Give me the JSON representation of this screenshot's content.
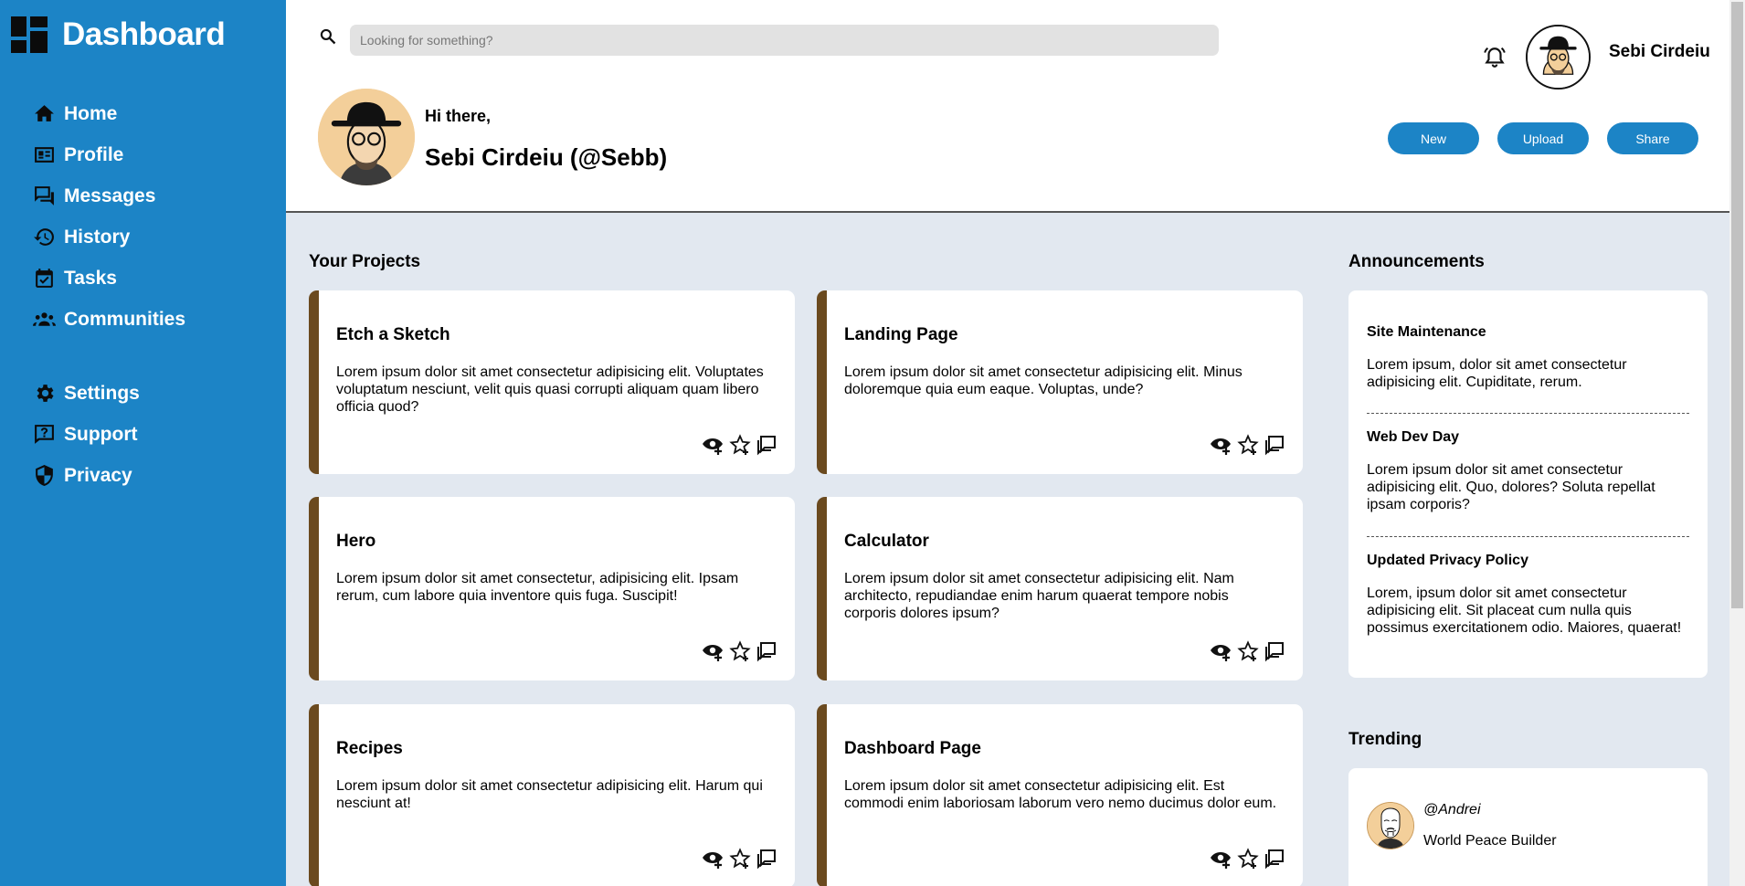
{
  "sidebar": {
    "brand": "Dashboard",
    "nav_primary": [
      {
        "label": "Home",
        "icon": "home-icon"
      },
      {
        "label": "Profile",
        "icon": "profile-card-icon"
      },
      {
        "label": "Messages",
        "icon": "messages-icon"
      },
      {
        "label": "History",
        "icon": "history-icon"
      },
      {
        "label": "Tasks",
        "icon": "tasks-icon"
      },
      {
        "label": "Communities",
        "icon": "communities-icon"
      }
    ],
    "nav_secondary": [
      {
        "label": "Settings",
        "icon": "gear-icon"
      },
      {
        "label": "Support",
        "icon": "support-icon"
      },
      {
        "label": "Privacy",
        "icon": "shield-icon"
      }
    ]
  },
  "header": {
    "search_placeholder": "Looking for something?",
    "user_name": "Sebi Cirdeiu",
    "greeting": "Hi there,",
    "full_name": "Sebi Cirdeiu (@Sebb)",
    "buttons": {
      "new": "New",
      "upload": "Upload",
      "share": "Share"
    }
  },
  "projects": {
    "title": "Your Projects",
    "items": [
      {
        "title": "Etch a Sketch",
        "desc": "Lorem ipsum dolor sit amet consectetur adipisicing elit. Voluptates voluptatum nesciunt, velit quis quasi corrupti aliquam quam libero officia quod?"
      },
      {
        "title": "Landing Page",
        "desc": "Lorem ipsum dolor sit amet consectetur adipisicing elit. Minus doloremque quia eum eaque. Voluptas, unde?"
      },
      {
        "title": "Hero",
        "desc": "Lorem ipsum dolor sit amet consectetur, adipisicing elit. Ipsam rerum, cum labore quia inventore quis fuga. Suscipit!"
      },
      {
        "title": "Calculator",
        "desc": "Lorem ipsum dolor sit amet consectetur adipisicing elit. Nam architecto, repudiandae enim harum quaerat tempore nobis corporis dolores ipsum?"
      },
      {
        "title": "Recipes",
        "desc": "Lorem ipsum dolor sit amet consectetur adipisicing elit. Harum qui nesciunt at!"
      },
      {
        "title": "Dashboard Page",
        "desc": "Lorem ipsum dolor sit amet consectetur adipisicing elit. Est commodi enim laboriosam laborum vero nemo ducimus dolor eum."
      }
    ]
  },
  "announcements": {
    "title": "Announcements",
    "items": [
      {
        "title": "Site Maintenance",
        "text": "Lorem ipsum, dolor sit amet consectetur adipisicing elit. Cupiditate, rerum."
      },
      {
        "title": "Web Dev Day",
        "text": "Lorem ipsum dolor sit amet consectetur adipisicing elit. Quo, dolores? Soluta repellat ipsam corporis?"
      },
      {
        "title": "Updated Privacy Policy",
        "text": "Lorem, ipsum dolor sit amet consectetur adipisicing elit. Sit placeat cum nulla quis possimus exercitationem odio. Maiores, quaerat!"
      }
    ]
  },
  "trending": {
    "title": "Trending",
    "items": [
      {
        "handle": "@Andrei",
        "role": "World Peace Builder"
      }
    ]
  },
  "colors": {
    "sidebar": "#1c84c6",
    "accent": "#1c84c6",
    "card_border": "#6b4a1f",
    "background": "#e2e8f0"
  }
}
